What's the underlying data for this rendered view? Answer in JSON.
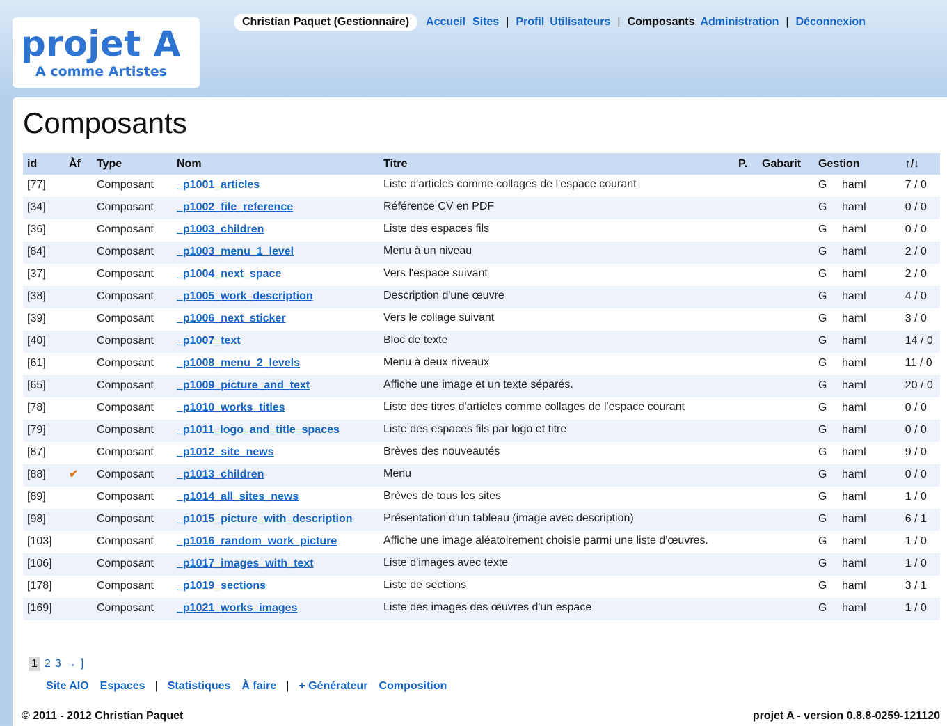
{
  "logo": {
    "main": "projet A",
    "sub": "A comme Artistes"
  },
  "topnav": {
    "user": "Christian Paquet (Gestionnaire)",
    "accueil": "Accueil",
    "sites": "Sites",
    "sep1": "|",
    "profil": "Profil",
    "utilisateurs": "Utilisateurs",
    "sep2": "|",
    "composants": "Composants",
    "administration": "Administration",
    "sep3": "|",
    "deconnexion": "Déconnexion"
  },
  "page": {
    "title": "Composants"
  },
  "table": {
    "headers": {
      "id": "id",
      "af": "Àf",
      "type": "Type",
      "nom": "Nom",
      "titre": "Titre",
      "p": "P.",
      "gabarit": "Gabarit",
      "gestion": "Gestion",
      "sort": "↑/↓"
    },
    "rows": [
      {
        "id": "[77]",
        "af": "",
        "type": "Composant",
        "nom": "_p1001_articles",
        "titre": "Liste d'articles comme collages de l'espace courant",
        "g": "G",
        "format": "haml",
        "ratio": "7 / 0"
      },
      {
        "id": "[34]",
        "af": "",
        "type": "Composant",
        "nom": "_p1002_file_reference",
        "titre": "Référence CV en PDF",
        "g": "G",
        "format": "haml",
        "ratio": "0 / 0"
      },
      {
        "id": "[36]",
        "af": "",
        "type": "Composant",
        "nom": "_p1003_children",
        "titre": "Liste des espaces fils",
        "g": "G",
        "format": "haml",
        "ratio": "0 / 0"
      },
      {
        "id": "[84]",
        "af": "",
        "type": "Composant",
        "nom": "_p1003_menu_1_level",
        "titre": "Menu à un niveau",
        "g": "G",
        "format": "haml",
        "ratio": "2 / 0"
      },
      {
        "id": "[37]",
        "af": "",
        "type": "Composant",
        "nom": "_p1004_next_space",
        "titre": "Vers l'espace suivant",
        "g": "G",
        "format": "haml",
        "ratio": "2 / 0"
      },
      {
        "id": "[38]",
        "af": "",
        "type": "Composant",
        "nom": "_p1005_work_description",
        "titre": "Description d'une œuvre",
        "g": "G",
        "format": "haml",
        "ratio": "4 / 0"
      },
      {
        "id": "[39]",
        "af": "",
        "type": "Composant",
        "nom": "_p1006_next_sticker",
        "titre": "Vers le collage suivant",
        "g": "G",
        "format": "haml",
        "ratio": "3 / 0"
      },
      {
        "id": "[40]",
        "af": "",
        "type": "Composant",
        "nom": "_p1007_text",
        "titre": "Bloc de texte",
        "g": "G",
        "format": "haml",
        "ratio": "14 / 0"
      },
      {
        "id": "[61]",
        "af": "",
        "type": "Composant",
        "nom": "_p1008_menu_2_levels",
        "titre": "Menu à deux niveaux",
        "g": "G",
        "format": "haml",
        "ratio": "11 / 0"
      },
      {
        "id": "[65]",
        "af": "",
        "type": "Composant",
        "nom": "_p1009_picture_and_text",
        "titre": "Affiche une image et un texte séparés.",
        "g": "G",
        "format": "haml",
        "ratio": "20 / 0"
      },
      {
        "id": "[78]",
        "af": "",
        "type": "Composant",
        "nom": "_p1010_works_titles",
        "titre": "Liste des titres d'articles comme collages de l'espace courant",
        "g": "G",
        "format": "haml",
        "ratio": "0 / 0"
      },
      {
        "id": "[79]",
        "af": "",
        "type": "Composant",
        "nom": "_p1011_logo_and_title_spaces",
        "titre": "Liste des espaces fils par logo et titre",
        "g": "G",
        "format": "haml",
        "ratio": "0 / 0"
      },
      {
        "id": "[87]",
        "af": "",
        "type": "Composant",
        "nom": "_p1012_site_news",
        "titre": "Brèves des nouveautés",
        "g": "G",
        "format": "haml",
        "ratio": "9 / 0"
      },
      {
        "id": "[88]",
        "af": "✔",
        "type": "Composant",
        "nom": "_p1013_children",
        "titre": "Menu",
        "g": "G",
        "format": "haml",
        "ratio": "0 / 0"
      },
      {
        "id": "[89]",
        "af": "",
        "type": "Composant",
        "nom": "_p1014_all_sites_news",
        "titre": "Brèves de tous les sites",
        "g": "G",
        "format": "haml",
        "ratio": "1 / 0"
      },
      {
        "id": "[98]",
        "af": "",
        "type": "Composant",
        "nom": "_p1015_picture_with_description",
        "titre": "Présentation d'un tableau (image avec description)",
        "g": "G",
        "format": "haml",
        "ratio": "6 / 1"
      },
      {
        "id": "[103]",
        "af": "",
        "type": "Composant",
        "nom": "_p1016_random_work_picture",
        "titre": "Affiche une image aléatoirement choisie parmi une liste d'œuvres.",
        "g": "G",
        "format": "haml",
        "ratio": "1 / 0"
      },
      {
        "id": "[106]",
        "af": "",
        "type": "Composant",
        "nom": "_p1017_images_with_text",
        "titre": "Liste d'images avec texte",
        "g": "G",
        "format": "haml",
        "ratio": "1 / 0"
      },
      {
        "id": "[178]",
        "af": "",
        "type": "Composant",
        "nom": "_p1019_sections",
        "titre": "Liste de sections",
        "g": "G",
        "format": "haml",
        "ratio": "3 / 1"
      },
      {
        "id": "[169]",
        "af": "",
        "type": "Composant",
        "nom": "_p1021_works_images",
        "titre": "Liste des images des œuvres d'un espace",
        "g": "G",
        "format": "haml",
        "ratio": "1 / 0"
      }
    ]
  },
  "pager": {
    "current": "1",
    "p2": "2",
    "p3": "3",
    "next": "→",
    "end": "]"
  },
  "bottomnav": {
    "site_aio": "Site AIO",
    "espaces": "Espaces",
    "sep1": "|",
    "statistiques": "Statistiques",
    "a_faire": "À faire",
    "sep2": "|",
    "generateur": "+ Générateur",
    "composition": "Composition"
  },
  "footer": {
    "copyright": "© 2011 - 2012 Christian Paquet",
    "version": "projet A - version 0.8.8-0259-121120"
  }
}
